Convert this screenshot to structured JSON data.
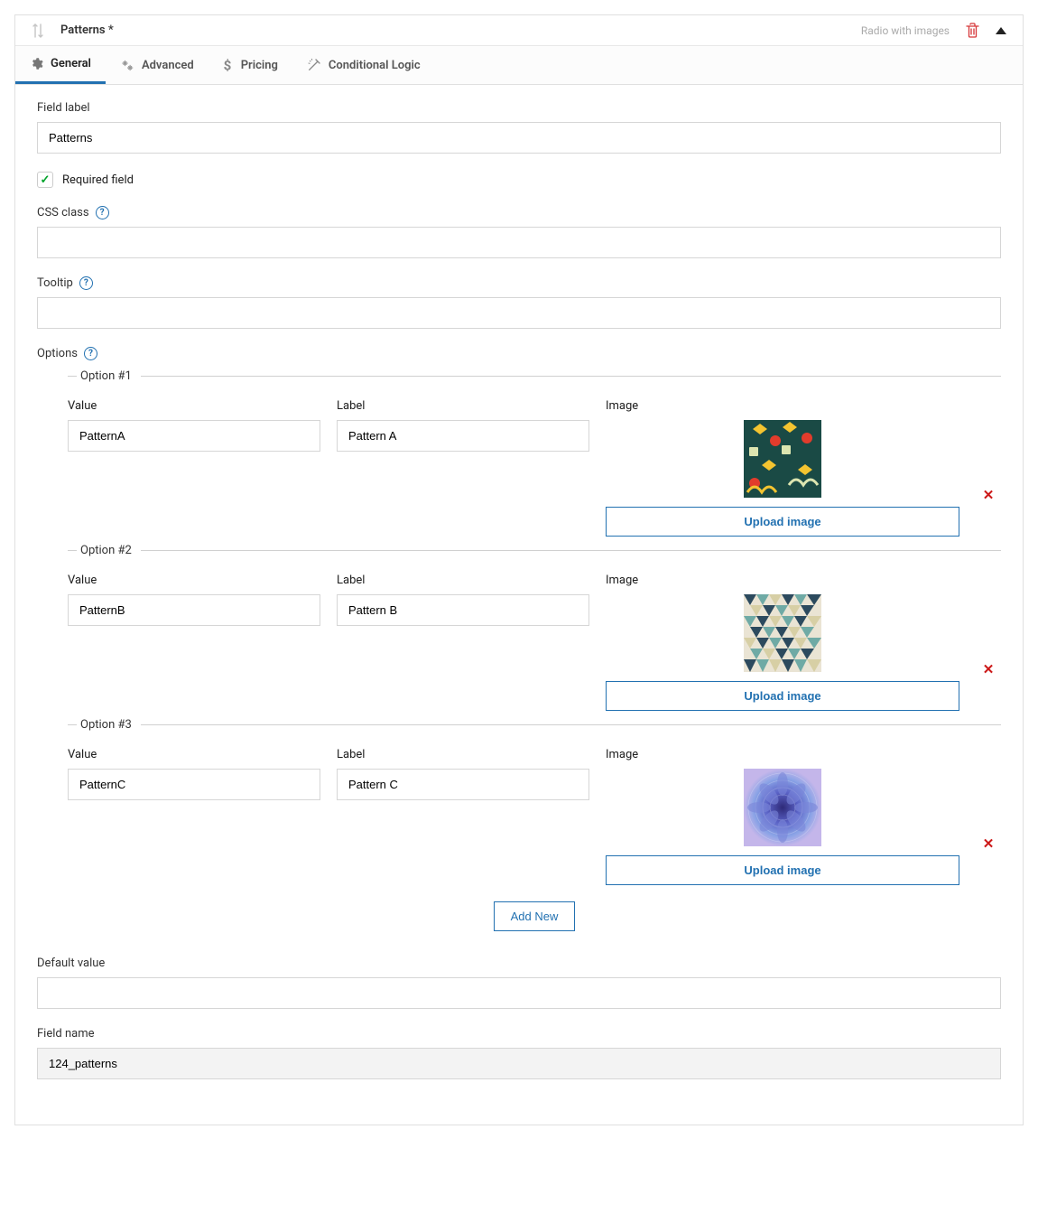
{
  "header": {
    "title": "Patterns *",
    "field_type": "Radio with images"
  },
  "tabs": {
    "general": "General",
    "advanced": "Advanced",
    "pricing": "Pricing",
    "conditional": "Conditional Logic"
  },
  "form": {
    "field_label": {
      "label": "Field label",
      "value": "Patterns"
    },
    "required": {
      "label": "Required field",
      "checked": true
    },
    "css_class": {
      "label": "CSS class",
      "value": ""
    },
    "tooltip": {
      "label": "Tooltip",
      "value": ""
    },
    "options_label": "Options",
    "options": [
      {
        "legend": "Option #1",
        "value_label": "Value",
        "value": "PatternA",
        "label_label": "Label",
        "label": "Pattern A",
        "image_label": "Image",
        "upload_label": "Upload image"
      },
      {
        "legend": "Option #2",
        "value_label": "Value",
        "value": "PatternB",
        "label_label": "Label",
        "label": "Pattern B",
        "image_label": "Image",
        "upload_label": "Upload image"
      },
      {
        "legend": "Option #3",
        "value_label": "Value",
        "value": "PatternC",
        "label_label": "Label",
        "label": "Pattern C",
        "image_label": "Image",
        "upload_label": "Upload image"
      }
    ],
    "add_new": "Add New",
    "default_value": {
      "label": "Default value",
      "value": ""
    },
    "field_name": {
      "label": "Field name",
      "value": "124_patterns"
    }
  }
}
